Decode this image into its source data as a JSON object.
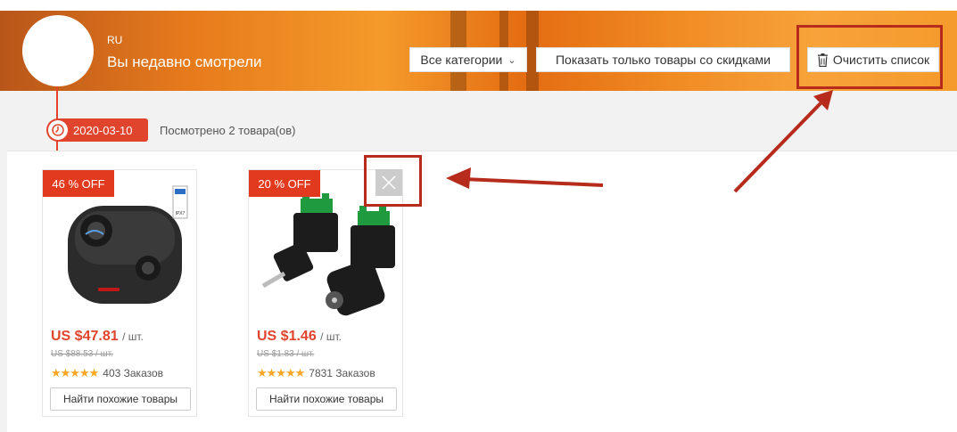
{
  "header": {
    "region": "RU",
    "title": "Вы недавно смотрели",
    "category_select": "Все категории",
    "discount_button": "Показать только товары со скидками",
    "clear_button": "Очистить список"
  },
  "timeline": {
    "date": "2020-03-10",
    "viewed_count": "Посмотрено 2 товара(ов)"
  },
  "products": [
    {
      "discount": "46 % OFF",
      "price": "US $47.81",
      "unit": "/ шт.",
      "old_price": "US $88.53 / шт.",
      "stars": "★★★★★",
      "orders": "403 Заказов",
      "similar": "Найти похожие товары",
      "icon": "wireless-earbuds-image"
    },
    {
      "discount": "20 % OFF",
      "price": "US $1.46",
      "unit": "/ шт.",
      "old_price": "US $1.83 / шт.",
      "stars": "★★★★★",
      "orders": "7831 Заказов",
      "similar": "Найти похожие товары",
      "icon": "dc-connector-image"
    }
  ],
  "colors": {
    "accent": "#e0442c",
    "badge": "#e23a1f",
    "annotation": "#b62b1c",
    "star": "#f6a623"
  }
}
